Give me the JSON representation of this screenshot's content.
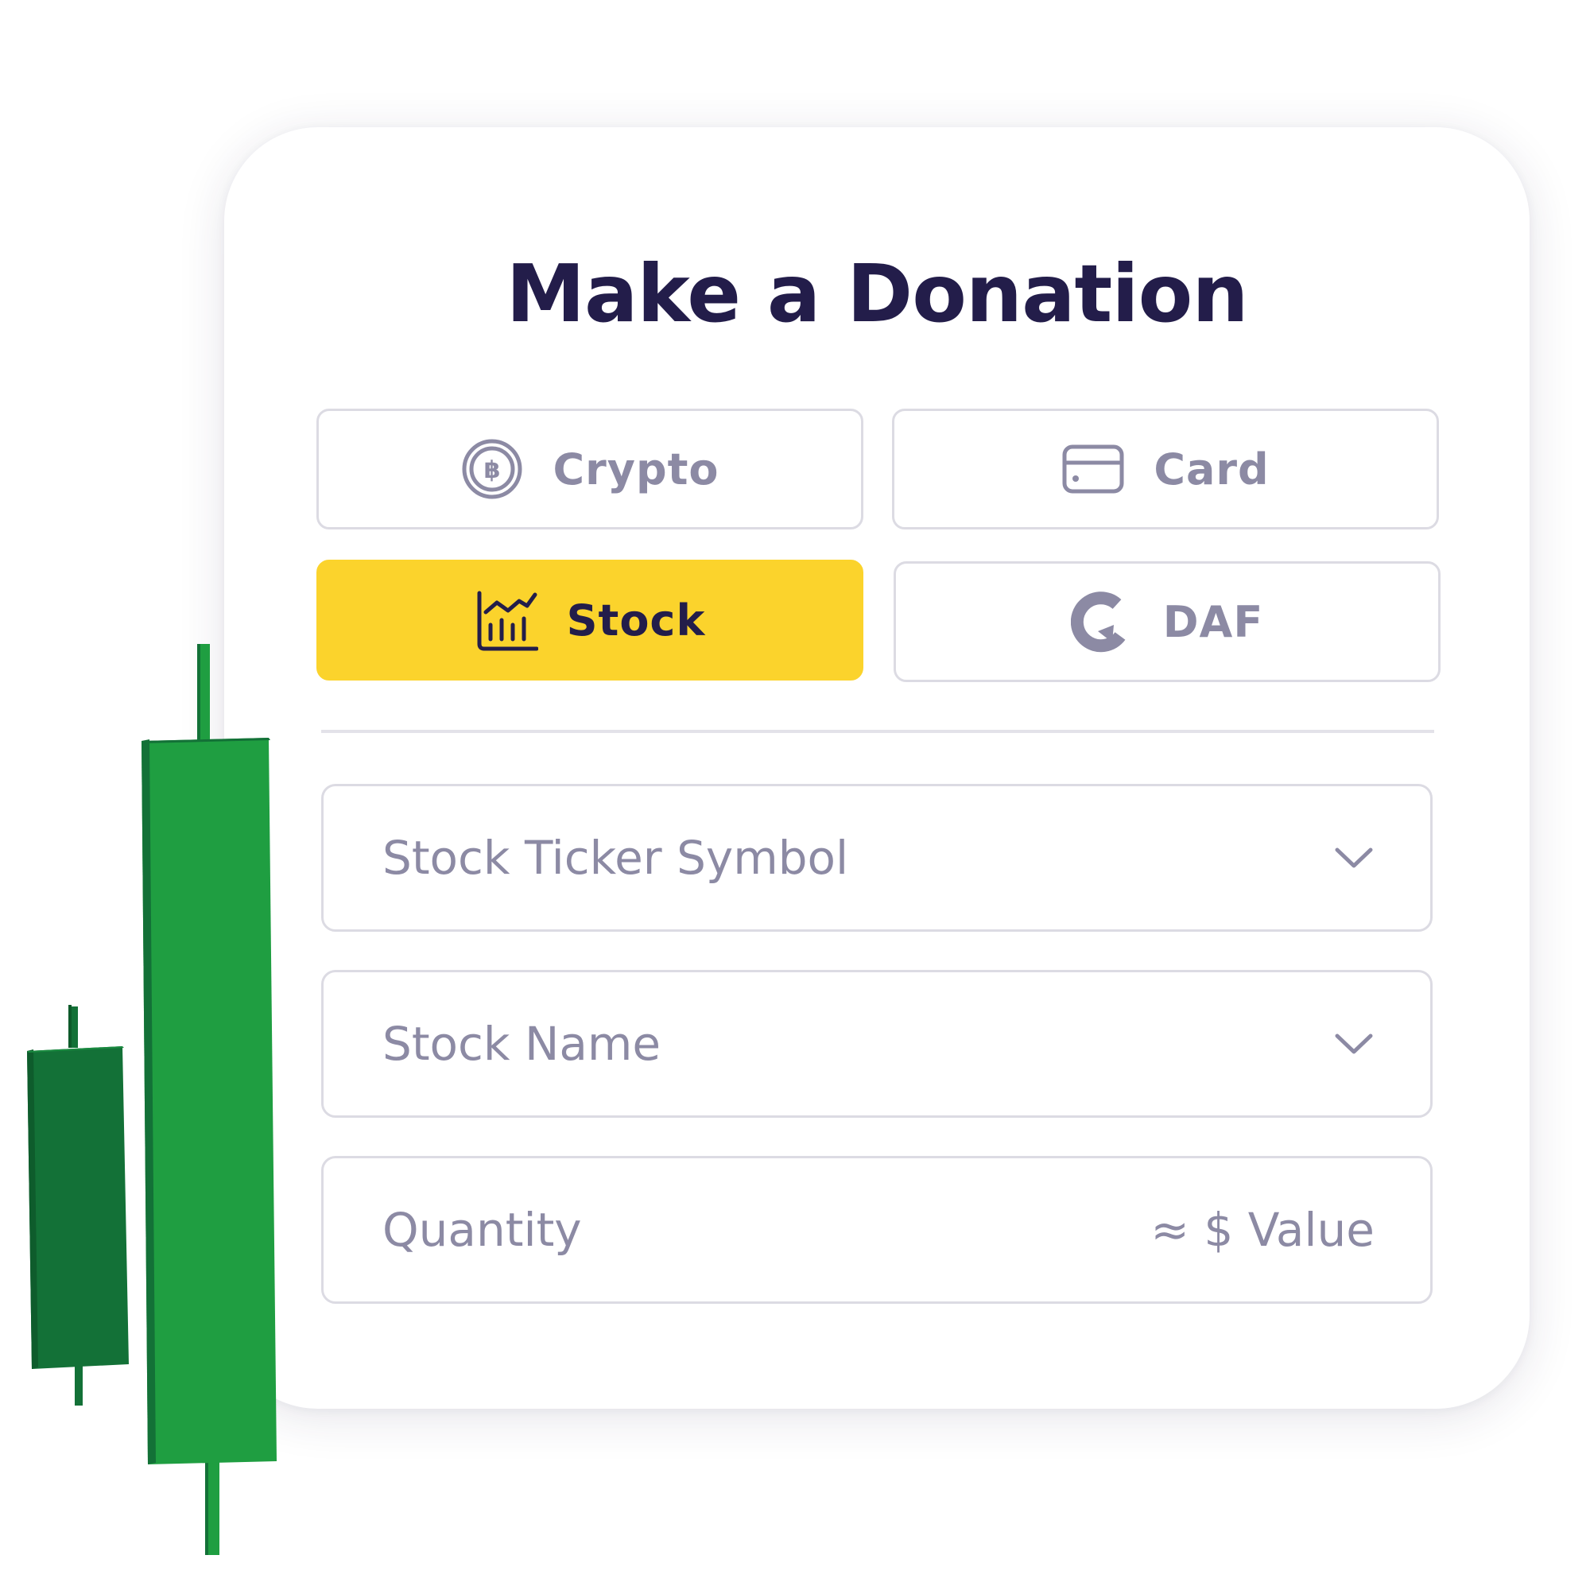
{
  "donation": {
    "title": "Make a Donation",
    "methods": [
      {
        "label": "Crypto",
        "icon": "bitcoin-icon",
        "selected": false
      },
      {
        "label": "Card",
        "icon": "credit-card-icon",
        "selected": false
      },
      {
        "label": "Stock",
        "icon": "stock-chart-icon",
        "selected": true
      },
      {
        "label": "DAF",
        "icon": "daf-icon",
        "selected": false
      }
    ],
    "fields": {
      "ticker": {
        "placeholder": "Stock Ticker Symbol",
        "icon": "chevron-down-icon"
      },
      "name": {
        "placeholder": "Stock Name",
        "icon": "chevron-down-icon"
      },
      "quantity": {
        "placeholder": "Quantity",
        "value_label": "≈ $ Value"
      }
    }
  },
  "colors": {
    "title": "#231d4a",
    "accent": "#fbd32c",
    "muted_text": "#8c8aa4",
    "border": "#dcdbe3",
    "candle_light": "#1f9e41",
    "candle_dark": "#137137"
  }
}
